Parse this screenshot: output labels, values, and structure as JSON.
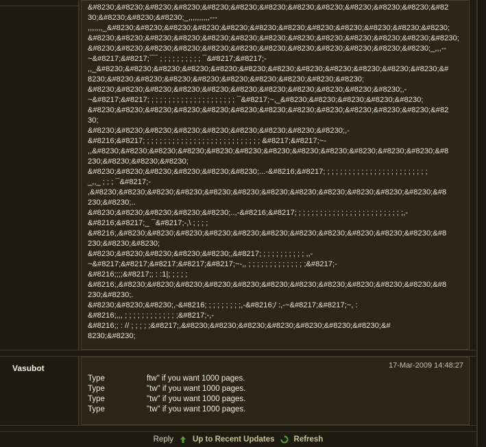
{
  "post1": {
    "lines": [
      "&#8230;&#8230;&#8230;&#8230;&#8230;&#8230;&#8230;&#8230;&#8230;&#8230;&#8230;&#8230;&#82",
      "30;&#8230;&#8230;&#8230;_,,,,,,,,,,---",
      ",,,,,,,_&#8230;&#8230;&#8230;&#8230;&#8230;&#8230;&#8230;&#8230;&#8230;&#8230;&#8230;&#8230;",
      "&#8230;&#8230;&#8230;&#8230;&#8230;&#8230;&#8230;&#8230;&#8230;&#8230;&#8230;&#8230;&#8230;",
      "&#8230;&#8230;&#8230;&#8230;&#8230;&#8230;&#8230;&#8230;&#8230;&#8230;&#8230;&#8230;_,,,--",
      "~&#8217;&#8217;¯¯ ; ; ; ; ; ; ; ; ; ; ¯&#8217;&#8217;-",
      ",,_&#8230;&#8230;&#8230;&#8230;&#8230;&#8230;&#8230;&#8230;&#8230;&#8230;&#8230;&#8230;&#",
      "8230;&#8230;&#8230;&#8230;&#8230;&#8230;&#8230;&#8230;&#8230;&#8230;",
      "&#8230;&#8230;&#8230;&#8230;&#8230;&#8230;&#8230;&#8230;&#8230;&#8230;&#8230;,-",
      "~&#8217;&#8217; ; ; ; ; ; ; ; ; ; ; ; ; ; ; ; ; ; ; ; ; ¯&#8217;~,_&#8230;&#8230;&#8230;&#8230;&#8230;",
      "&#8230;&#8230;&#8230;&#8230;&#8230;&#8230;&#8230;&#8230;&#8230;&#8230;&#8230;&#8230;&#82",
      "30;",
      "&#8230;&#8230;&#8230;&#8230;&#8230;&#8230;&#8230;&#8230;&#8230;,-",
      "&#8216;&#8217; ; ; ; ; ; ; ; ; ; ; ; ; ; ; ; ; ; ; ; ; ; ; ; ; ; ; ; &#8217;&#8217;~-",
      ",,&#8230;&#8230;&#8230;&#8230;&#8230;&#8230;&#8230;&#8230;&#8230;&#8230;&#8230;&#8230;&#8",
      "230;&#8230;&#8230;&#8230;",
      "&#8230;&#8230;&#8230;&#8230;&#8230;&#8230;...-&#8216;&#8217; ; ; ; ; ; ; ; ; ; ; ; ; ; ; ; ; ; ; ; ; ; ; ; ;",
      "_,,_ ; ; ; ¯&#8217;-",
      ",&#8230;&#8230;&#8230;&#8230;&#8230;&#8230;&#8230;&#8230;&#8230;&#8230;&#8230;&#8230;&#8",
      "230;&#8230;..",
      "&#8230;&#8230;&#8230;&#8230;&#8230;..,-&#8216;&#8217; ; ; ; ; ; ; ; ; ; ; ; ; ; ; ; ; ; ; ; ; ; ; ; ; ;,-",
      "&#8216;&#8217;_ ¯&#8217;-,\\ ; ; ; ;",
      "&#8216;,&#8230;&#8230;&#8230;&#8230;&#8230;&#8230;&#8230;&#8230;&#8230;&#8230;&#8230;&#8",
      "230;&#8230;&#8230;",
      "&#8230;&#8230;&#8230;&#8230;&#8230;,&#8217; ; ; ; ; ; ; ; ; ; ; ,,-",
      "~&#8217;&#8217;&#8217;&#8217;&#8217;~-,, ; ; ; ; ; ; ; ; ; ; ; ; ; ;&#8217;-",
      "&#8216;;;;&#8217;; : :1|; ; ; ; ;",
      "&#8216;,&#8230;&#8230;&#8230;&#8230;&#8230;&#8230;&#8230;&#8230;&#8230;&#8230;&#8230;&#8",
      "230;&#8230;.",
      "&#8230;&#8230;&#8230;,-&#8216; ; ; ; ; ; ; ; ;,-&#8216;/ :,-~&#8217;&#8217;~, :",
      "&#8216;,,, ; ; ; ; ; ; ; ; ; ; ; ; ;&#8217;-,-",
      "&#8216;; : // ; ; ; ; ;&#8217;,&#8230;&#8230;&#8230;&#8230;&#8230;&#8230;&#8230;&#",
      "8230;&#8230;"
    ]
  },
  "post2": {
    "username": "Vasubot",
    "timestamp": "17-Mar-2009 14:48:27",
    "lines": [
      {
        "a": "Type",
        "b": "ftw\" if you want 1000 pages."
      },
      {
        "a": "Type",
        "b": "\"tw\" if you want 1000 pages."
      },
      {
        "a": "Type",
        "b": "\"tw\" if you want 1000 pages."
      },
      {
        "a": "Type",
        "b": "\"tw\" if you want 1000 pages."
      }
    ]
  },
  "footer": {
    "reply": "Reply",
    "recent": "Up to Recent Updates",
    "refresh": "Refresh"
  },
  "colors": {
    "background": "#1e1c12",
    "content": "#2a2718",
    "link": "#c8c490"
  }
}
